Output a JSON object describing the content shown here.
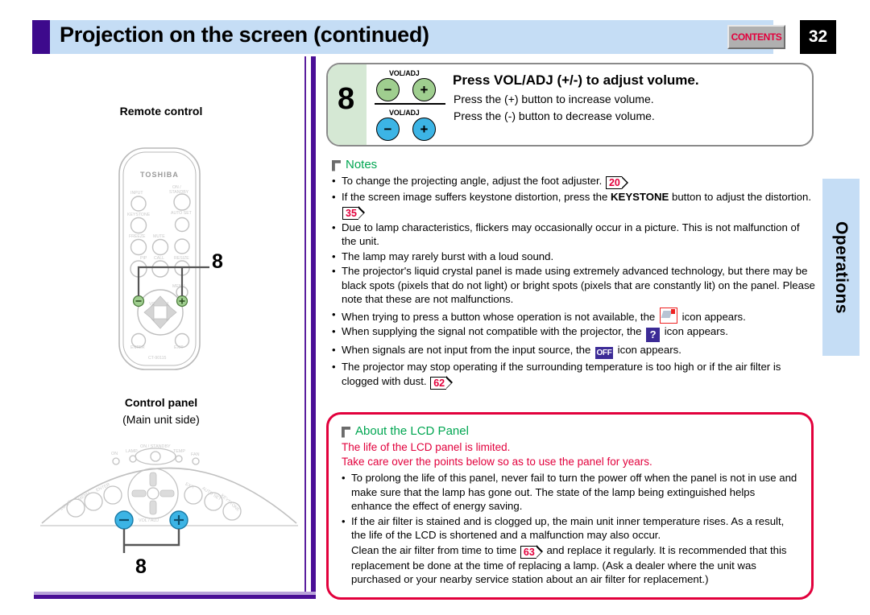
{
  "header": {
    "title": "Projection on the screen (continued)",
    "contents_label": "CONTENTS",
    "page_number": "32"
  },
  "side_tab": {
    "label": "Operations"
  },
  "left_column": {
    "remote_control_label": "Remote control",
    "remote_brand": "TOSHIBA",
    "remote_model": "CT-90115",
    "remote_callout": "8",
    "control_panel_label": "Control panel",
    "control_panel_sublabel": "(Main unit side)",
    "control_panel_callout": "8",
    "remote_buttons": [
      "INPUT",
      "ON / STANDBY",
      "KEYSTONE",
      "AUTO SET",
      "FREEZE",
      "MUTE",
      "RESIZE",
      "PIP",
      "CALL",
      "MENU",
      "VOL / ADJ",
      "ENTER",
      "EXIT"
    ],
    "panel_labels": [
      "ON / STANDBY",
      "ON",
      "LAMP",
      "TEMP",
      "FAN",
      "INPUT",
      "MENU",
      "ENTER",
      "EXIT",
      "AUTO SET",
      "KEYSTONE",
      "VOL / ADJ"
    ]
  },
  "step": {
    "number": "8",
    "vol_label_top": "VOL/ADJ",
    "vol_label_bottom": "VOL/ADJ",
    "minus_symbol": "−",
    "plus_symbol": "+",
    "title": "Press VOL/ADJ (+/-) to adjust volume.",
    "sub1": "Press the (+) button to increase volume.",
    "sub2": "Press the (-) button to decrease volume."
  },
  "notes": {
    "title": "Notes",
    "items": [
      {
        "parts": [
          {
            "t": "text",
            "v": "To change the projecting angle, adjust the foot adjuster. "
          },
          {
            "t": "pageref",
            "v": "20"
          }
        ]
      },
      {
        "parts": [
          {
            "t": "text",
            "v": "If the screen image suffers keystone distortion, press the "
          },
          {
            "t": "bold",
            "v": "KEYSTONE"
          },
          {
            "t": "text",
            "v": " button to adjust the distortion. "
          },
          {
            "t": "pageref",
            "v": "35"
          }
        ]
      },
      {
        "parts": [
          {
            "t": "text",
            "v": "Due to lamp characteristics, flickers may occasionally occur in a picture. This is not malfunction of the unit."
          }
        ]
      },
      {
        "parts": [
          {
            "t": "text",
            "v": "The lamp may rarely burst with a loud sound."
          }
        ]
      },
      {
        "parts": [
          {
            "t": "text",
            "v": "The projector's liquid crystal panel is made using extremely advanced technology, but there may be black spots (pixels that do not light) or bright spots (pixels that are constantly lit) on the panel. Please note that these are not malfunctions."
          }
        ]
      },
      {
        "parts": [
          {
            "t": "text",
            "v": "When trying to press a button whose operation is not available, the "
          },
          {
            "t": "icon",
            "v": "no-operation-icon"
          },
          {
            "t": "text",
            "v": " icon appears."
          }
        ]
      },
      {
        "parts": [
          {
            "t": "text",
            "v": "When supplying the signal not compatible with the projector, the "
          },
          {
            "t": "icon",
            "v": "question-icon"
          },
          {
            "t": "text",
            "v": " icon appears."
          }
        ]
      },
      {
        "parts": [
          {
            "t": "text",
            "v": "When signals are not input from the input source, the "
          },
          {
            "t": "icon",
            "v": "off-icon"
          },
          {
            "t": "text",
            "v": " icon appears."
          }
        ]
      },
      {
        "parts": [
          {
            "t": "text",
            "v": "The projector may stop operating if the surrounding temperature is too high or if the air filter is clogged with dust. "
          },
          {
            "t": "pageref",
            "v": "62"
          }
        ]
      }
    ]
  },
  "lcd_panel": {
    "title": "About the LCD Panel",
    "red_line1": "The life of the LCD panel is limited.",
    "red_line2": "Take care over the points below so as to use the panel for years.",
    "items": [
      {
        "bullet": true,
        "parts": [
          {
            "t": "text",
            "v": "To prolong the life of this panel, never fail to turn the power off when the panel is not in use and make sure that the lamp has gone out. The state of the lamp being extinguished helps enhance the effect of energy saving."
          }
        ]
      },
      {
        "bullet": true,
        "parts": [
          {
            "t": "text",
            "v": "If the air filter is stained and is clogged up, the main unit inner temperature rises. As a result, the life of the LCD is shortened and a malfunction may also occur."
          }
        ]
      },
      {
        "bullet": false,
        "parts": [
          {
            "t": "text",
            "v": "Clean the air filter from time to time "
          },
          {
            "t": "pageref",
            "v": "63"
          },
          {
            "t": "text",
            "v": " and replace it regularly. It is recommended that this replacement be done at the time of replacing a lamp. (Ask a dealer where the unit was purchased or your nearby service station about an air filter for replacement.)"
          }
        ]
      }
    ]
  },
  "colors": {
    "header_bg": "#c5ddf5",
    "header_accent": "#3d0a8c",
    "divider_purple": "#4a0f96",
    "green_text": "#00a651",
    "red": "#e2003c",
    "step_panel_green": "#d5e8d4",
    "button_green": "#9fce8f",
    "button_blue": "#3cb4e5",
    "icon_purple": "#3c2b96"
  },
  "icon_names": {
    "no_operation": "no-operation-icon",
    "question": "question-icon",
    "off": "off-icon",
    "flag": "flag-marker-icon",
    "page_ref": "page-reference-arrow-icon"
  }
}
